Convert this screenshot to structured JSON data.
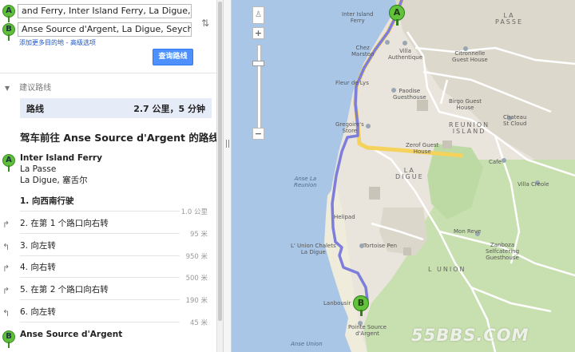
{
  "directions": {
    "from_value": "and Ferry, Inter Island Ferry, La Digue, 塞舌尔",
    "to_value": "Anse Source d'Argent, La Digue, Seychelles",
    "from_marker": "A",
    "to_marker": "B",
    "add_destination_link": "添加更多目的地",
    "options_link": "高级选项",
    "search_button": "查询路线",
    "suggested_routes_label": "建议路线",
    "route_label": "路线",
    "route_summary": "2.7 公里，5 分钟",
    "heading": "驾车前往 Anse Source d'Argent 的路线",
    "origin": {
      "name": "Inter Island Ferry",
      "line2": "La Passe",
      "line3": "La Digue, 塞舌尔"
    },
    "steps": [
      {
        "text": "1. 向西南行驶",
        "turn": "",
        "dist": "1.0 公里"
      },
      {
        "text": "2. 在第 1 个路口向右转",
        "turn": "right-turn-icon",
        "dist": "95 米"
      },
      {
        "text": "3. 向左转",
        "turn": "left-turn-icon",
        "dist": "950 米"
      },
      {
        "text": "4. 向右转",
        "turn": "right-turn-icon",
        "dist": "500 米"
      },
      {
        "text": "5. 在第 2 个路口向右转",
        "turn": "right-turn-icon",
        "dist": "190 米"
      },
      {
        "text": "6. 向左转",
        "turn": "left-turn-icon",
        "dist": "45 米"
      }
    ],
    "destination": "Anse Source d'Argent"
  },
  "map": {
    "labels": {
      "inter_island_ferry": "Inter Island\nFerry",
      "la_passe": "LA\nPASSE",
      "chez_marston": "Chez\nMarston",
      "villa_authentique": "Villa\nAuthentique",
      "citronnelle": "Citronnelle\nGuest House",
      "fleur_de_lys": "Fleur de Lys",
      "paodise": "Paodise\nGuesthouse",
      "birgo": "Birgo Guest\nHouse",
      "chateau": "Chateau\nSt Cloud",
      "reunion_island": "REUNION\nISLAND",
      "gregoire": "Gregoire's\nStore",
      "zerof": "Zerof Guest\nHouse",
      "cafe": "Cafe",
      "la_digue": "LA\nDIGUE",
      "villa_creole": "Villa Creole",
      "anse_la_reunion": "Anse La\nReunion",
      "helipad": "Helipad",
      "mon_reve": "Mon Reve",
      "union_chalets": "L' Union Chalets\nLa Digue",
      "tortoise_pen": "Tortoise Pen",
      "zanboza": "Zanboza\nSelfcatering\nGuesthouse",
      "l_union": "L UNION",
      "lanbousir": "Lanbousir",
      "pointe_source": "Pointe Source\nd'Argent",
      "anse_union": "Anse Union"
    },
    "zoom_in": "+",
    "zoom_out": "−",
    "pin_a": "A",
    "pin_b": "B",
    "watermark": "55BBS.COM",
    "colors": {
      "water": "#aac6e6",
      "land": "#e9e5dc",
      "vegetation": "#c8dfaf",
      "route": "#7d7ddc",
      "main_road": "#f4d25c"
    }
  }
}
